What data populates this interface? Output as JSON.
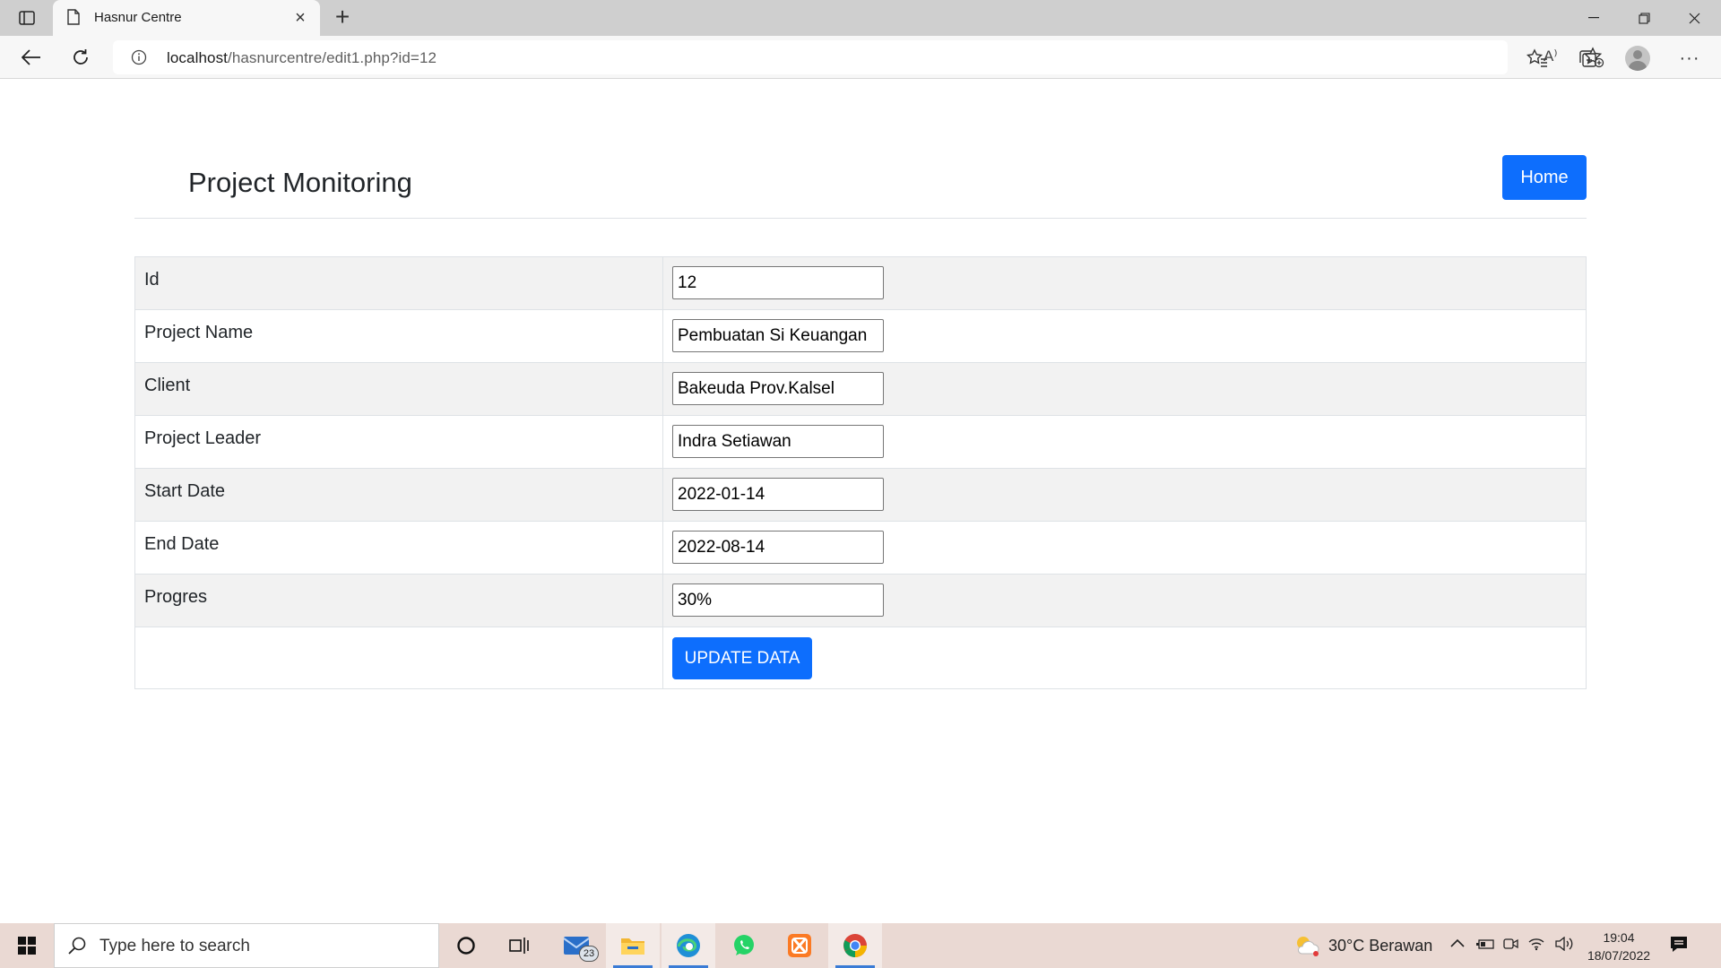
{
  "browser": {
    "tab_title": "Hasnur Centre",
    "url_host": "localhost",
    "url_path": "/hasnurcentre/edit1.php?id=12",
    "read_aloud": "A⁾"
  },
  "page": {
    "brand": "Project Monitoring",
    "home_label": "Home",
    "fields": [
      {
        "label": "Id",
        "value": "12"
      },
      {
        "label": "Project Name",
        "value": "Pembuatan Si Keuangan"
      },
      {
        "label": "Client",
        "value": "Bakeuda Prov.Kalsel"
      },
      {
        "label": "Project Leader",
        "value": "Indra Setiawan"
      },
      {
        "label": "Start Date",
        "value": "2022-01-14"
      },
      {
        "label": "End Date",
        "value": "2022-08-14"
      },
      {
        "label": "Progres",
        "value": "30%"
      }
    ],
    "submit_label": "UPDATE DATA",
    "accent_color": "#0d6efd"
  },
  "taskbar": {
    "search_placeholder": "Type here to search",
    "mail_badge": "23",
    "weather": "30°C  Berawan",
    "time": "19:04",
    "date": "18/07/2022"
  }
}
